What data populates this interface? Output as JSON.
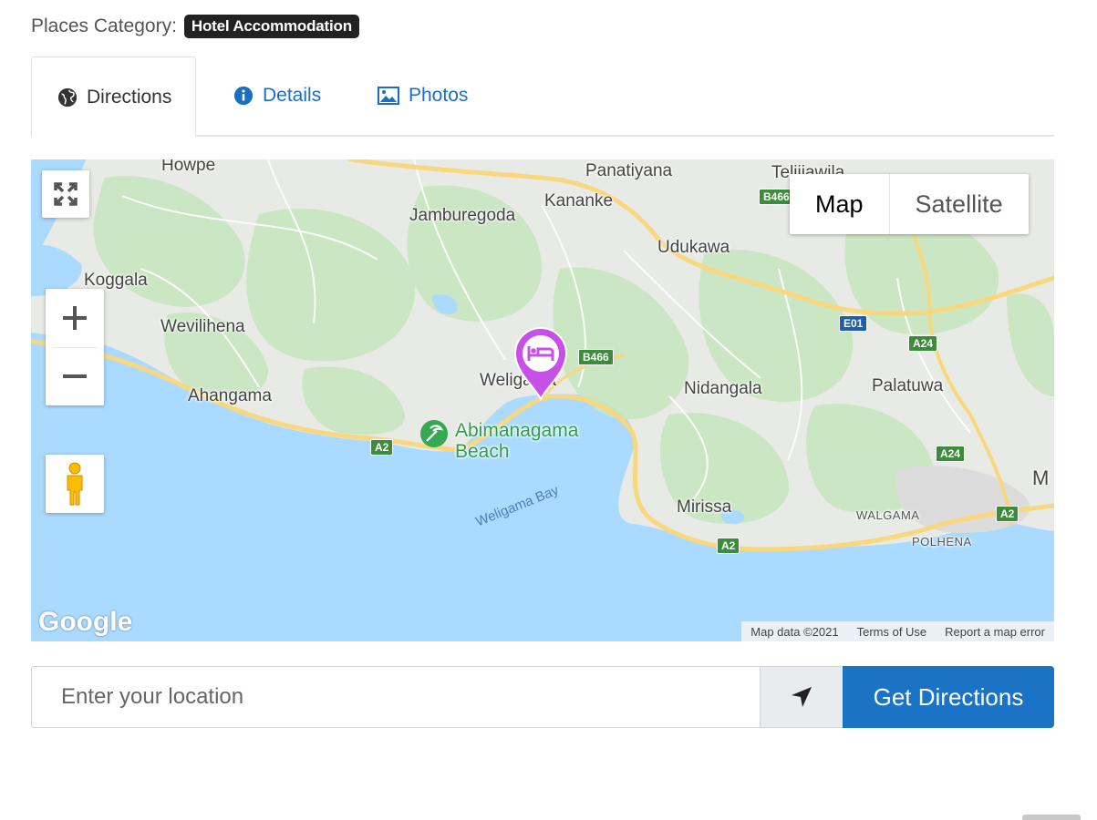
{
  "category": {
    "label": "Places Category:",
    "badge": "Hotel Accommodation"
  },
  "tabs": [
    {
      "label": "Directions",
      "icon": "globe-icon",
      "active": true
    },
    {
      "label": "Details",
      "icon": "info-icon",
      "active": false
    },
    {
      "label": "Photos",
      "icon": "image-icon",
      "active": false
    }
  ],
  "map": {
    "type_buttons": {
      "map": "Map",
      "satellite": "Satellite"
    },
    "places": {
      "howpe": "Howpe",
      "panatiyana": "Panatiyana",
      "telijjawila": "Telijjawila",
      "kananke": "Kananke",
      "jamburegoda": "Jamburegoda",
      "udukawa": "Udukawa",
      "koggala": "Koggala",
      "wevilihena": "Wevilihena",
      "weligama": "Weligama",
      "nidangala": "Nidangala",
      "palatuwa": "Palatuwa",
      "ahangama": "Ahangama",
      "beach": "Abimanagama Beach",
      "mirissa": "Mirissa",
      "walgama": "WALGAMA",
      "polhena": "POLHENA",
      "bay": "Weligama Bay",
      "m_edge": "M"
    },
    "roads": {
      "b466": "B466",
      "b466b": "B466",
      "e01": "E01",
      "a24a": "A24",
      "a24b": "A24",
      "a2a": "A2",
      "a2b": "A2",
      "a2c": "A2"
    },
    "logo": "Google",
    "attribution": [
      "Map data ©2021",
      "Terms of Use",
      "Report a map error"
    ],
    "colors": {
      "water": "#aadaff",
      "land": "#e8eae6",
      "park": "#c8e6c0",
      "road": "#f9d77e",
      "hotel_marker": "#c750e8",
      "beach_marker": "#34a853"
    }
  },
  "directions": {
    "placeholder": "Enter your location",
    "button": "Get Directions"
  },
  "colors": {
    "accent": "#1a73c4",
    "badge_bg": "#222222"
  }
}
